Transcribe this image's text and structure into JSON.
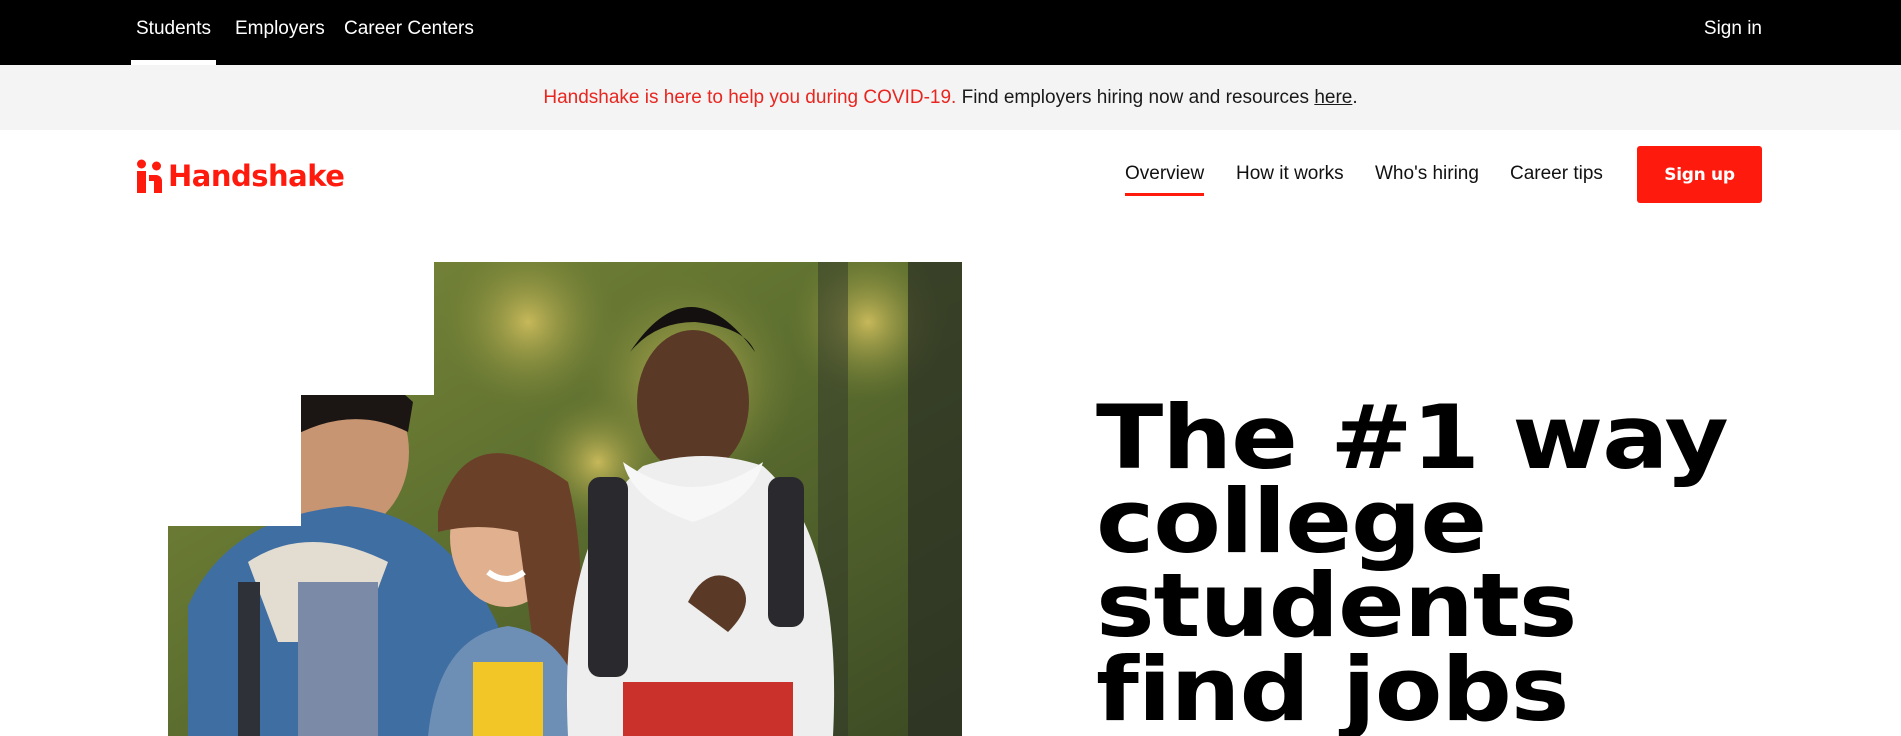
{
  "topbar": {
    "tabs": [
      {
        "label": "Students",
        "active": true
      },
      {
        "label": "Employers",
        "active": false
      },
      {
        "label": "Career Centers",
        "active": false
      }
    ],
    "sign_in": "Sign in"
  },
  "banner": {
    "alert_text": "Handshake is here to help you during COVID-19.",
    "body_text": " Find employers hiring now and resources ",
    "link_text": "here",
    "end_text": "."
  },
  "nav": {
    "logo_text": "Handshake",
    "links": [
      {
        "label": "Overview",
        "active": true
      },
      {
        "label": "How it works",
        "active": false
      },
      {
        "label": "Who's hiring",
        "active": false
      },
      {
        "label": "Career tips",
        "active": false
      }
    ],
    "cta": "Sign up"
  },
  "hero": {
    "headline_lines": [
      "The #1 way",
      "college",
      "students",
      "find jobs"
    ]
  },
  "colors": {
    "brand_red": "#ff1a0e",
    "alert_red": "#e8261f",
    "topbar_bg": "#000000",
    "banner_bg": "#f4f4f5"
  },
  "icons": {
    "logo_mark": "handshake-people-icon"
  }
}
